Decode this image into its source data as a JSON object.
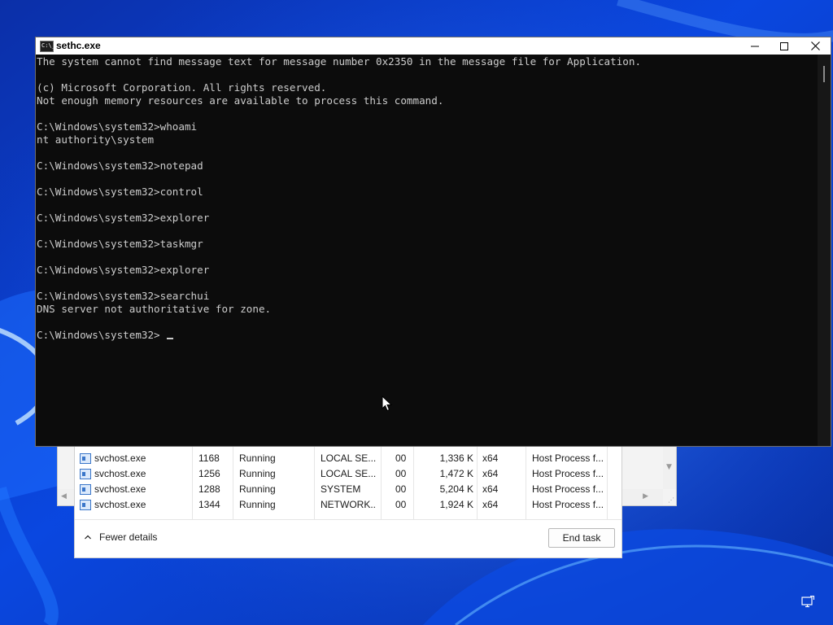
{
  "console": {
    "title": "sethc.exe",
    "icon_name": "console-app-icon",
    "icon_text": "C:\\_",
    "lines": [
      "The system cannot find message text for message number 0x2350 in the message file for Application.",
      "",
      "(c) Microsoft Corporation. All rights reserved.",
      "Not enough memory resources are available to process this command.",
      "",
      "C:\\Windows\\system32>whoami",
      "nt authority\\system",
      "",
      "C:\\Windows\\system32>notepad",
      "",
      "C:\\Windows\\system32>control",
      "",
      "C:\\Windows\\system32>explorer",
      "",
      "C:\\Windows\\system32>taskmgr",
      "",
      "C:\\Windows\\system32>explorer",
      "",
      "C:\\Windows\\system32>searchui",
      "DNS server not authoritative for zone.",
      "",
      "C:\\Windows\\system32>"
    ]
  },
  "taskmgr": {
    "rows": [
      {
        "name": "svchost.exe",
        "pid": "1168",
        "status": "Running",
        "user": "LOCAL SE...",
        "session": "00",
        "memory": "1,336 K",
        "arch": "x64",
        "desc": "Host Process f..."
      },
      {
        "name": "svchost.exe",
        "pid": "1256",
        "status": "Running",
        "user": "LOCAL SE...",
        "session": "00",
        "memory": "1,472 K",
        "arch": "x64",
        "desc": "Host Process f..."
      },
      {
        "name": "svchost.exe",
        "pid": "1288",
        "status": "Running",
        "user": "SYSTEM",
        "session": "00",
        "memory": "5,204 K",
        "arch": "x64",
        "desc": "Host Process f..."
      },
      {
        "name": "svchost.exe",
        "pid": "1344",
        "status": "Running",
        "user": "NETWORK...",
        "session": "00",
        "memory": "1,924 K",
        "arch": "x64",
        "desc": "Host Process f..."
      }
    ],
    "fewer_details_label": "Fewer details",
    "end_task_label": "End task"
  },
  "colors": {
    "console_bg": "#0c0c0c",
    "console_text": "#cccccc",
    "wallpaper_blue": "#0a3fd6"
  },
  "tray": {
    "icon_name": "remote-desktop-icon"
  }
}
